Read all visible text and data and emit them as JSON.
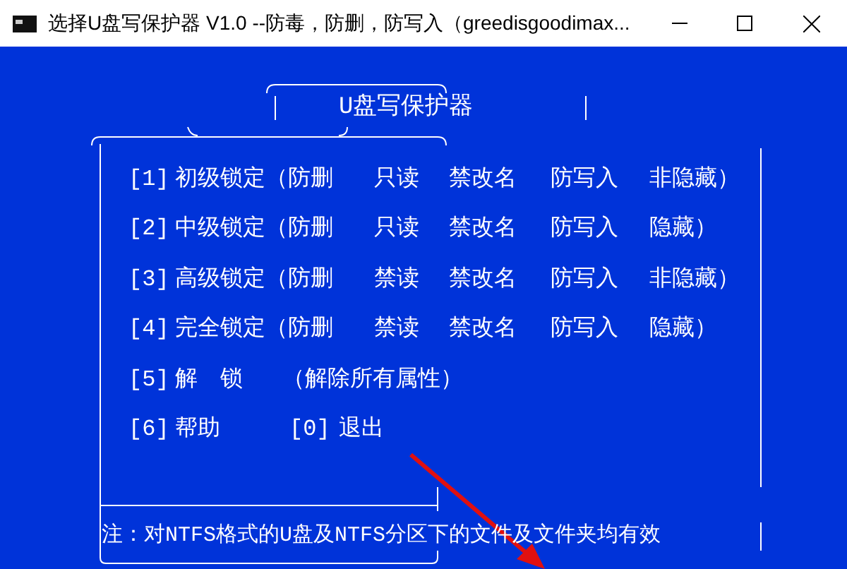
{
  "window": {
    "title": "选择U盘写保护器 V1.0  --防毒，防删，防写入（greedisgoodimax..."
  },
  "heading": "U盘写保护器",
  "menu": [
    {
      "kind": "lock",
      "code": "[1]",
      "name": "初级锁定（防删",
      "attrs": [
        "只读",
        "禁改名",
        "防写入",
        "非隐藏）"
      ]
    },
    {
      "kind": "lock",
      "code": "[2]",
      "name": "中级锁定（防删",
      "attrs": [
        "只读",
        "禁改名",
        "防写入",
        "隐藏）"
      ]
    },
    {
      "kind": "lock",
      "code": "[3]",
      "name": "高级锁定（防删",
      "attrs": [
        "禁读",
        "禁改名",
        "防写入",
        "非隐藏）"
      ]
    },
    {
      "kind": "lock",
      "code": "[4]",
      "name": "完全锁定（防删",
      "attrs": [
        "禁读",
        "禁改名",
        "防写入",
        "隐藏）"
      ]
    },
    {
      "kind": "unlock",
      "code": "[5]",
      "name": "解　锁",
      "note": "（解除所有属性）"
    },
    {
      "kind": "pair",
      "code": "[6]",
      "name": "帮助",
      "code2": "[0]",
      "name2": "退出"
    }
  ],
  "footnote": "注：对NTFS格式的U盘及NTFS分区下的文件及文件夹均有效"
}
